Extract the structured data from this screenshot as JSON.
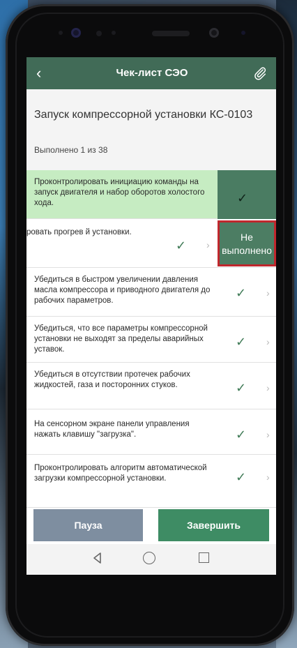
{
  "header": {
    "title": "Чек-лист СЭО",
    "back_icon": "chevron-left-icon",
    "attach_icon": "paperclip-icon"
  },
  "task": {
    "title": "Запуск компрессорной установки КС-0103",
    "progress": "Выполнено 1 из 38"
  },
  "checklist": {
    "items": [
      {
        "text": "Проконтролировать инициацию команды на запуск двигателя и набор оборотов холостого хода.",
        "status": "done",
        "check": "✓"
      },
      {
        "text": "ровать прогрев й установки.",
        "status": "swiped",
        "check": "✓",
        "chevron": "›"
      },
      {
        "text": "Убедиться в быстром увеличении давления масла компрессора и приводного двигателя до рабочих параметров.",
        "check": "✓",
        "chevron": "›"
      },
      {
        "text": "Убедиться, что все параметры компрессорной установки не выходят за пределы аварийных уставок.",
        "check": "✓",
        "chevron": "›"
      },
      {
        "text": "Убедиться в отсутствии протечек рабочих жидкостей, газа и посторонних стуков.",
        "check": "✓",
        "chevron": "›"
      },
      {
        "text": "На сенсорном экране панели управления нажать клавишу \"загрузка\".",
        "check": "✓",
        "chevron": "›"
      },
      {
        "text": "Проконтролировать алгоритм автоматической загрузки компрессорной установки.",
        "check": "✓",
        "chevron": "›"
      }
    ],
    "swipe_action_label": "Не выполнено"
  },
  "footer": {
    "pause_label": "Пауза",
    "finish_label": "Завершить"
  },
  "colors": {
    "header_bg": "#416b57",
    "done_bg": "#c6ecc2",
    "done_pane": "#4a7c62",
    "pause_btn": "#7e8ea0",
    "finish_btn": "#3e8c64",
    "highlight_border": "#c0272d"
  }
}
